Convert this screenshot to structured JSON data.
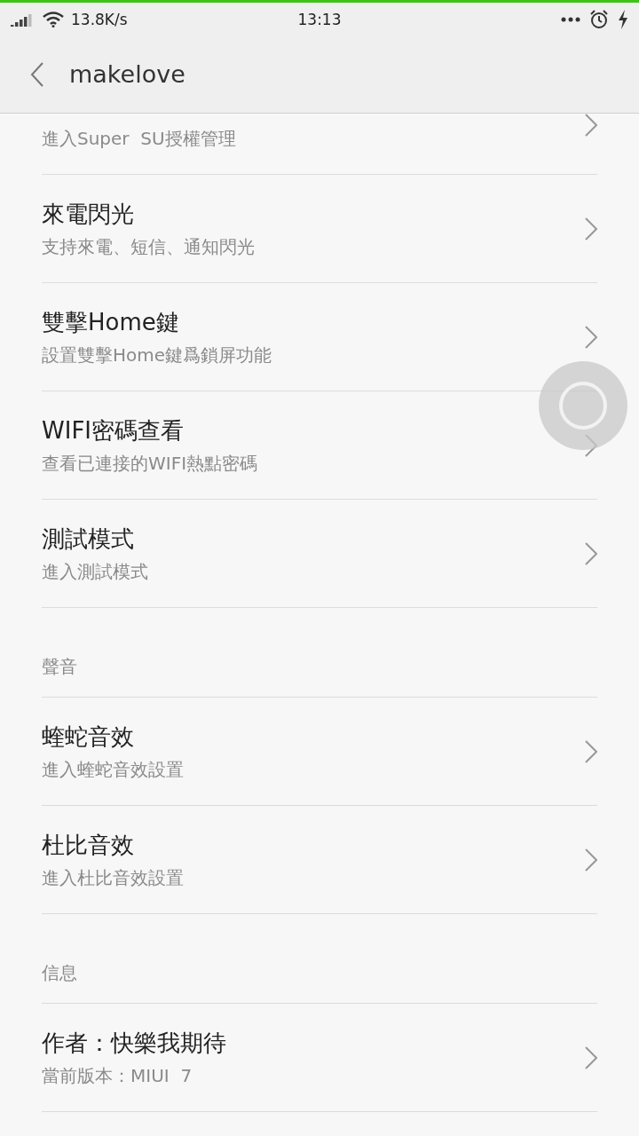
{
  "status_bar": {
    "speed": "13.8K/s",
    "time": "13:13"
  },
  "header": {
    "title": "makelove"
  },
  "list": [
    {
      "kind": "row",
      "subtitle": "進入Super  SU授權管理"
    },
    {
      "kind": "row",
      "title": "來電閃光",
      "subtitle": "支持來電、短信、通知閃光"
    },
    {
      "kind": "row",
      "title": "雙擊Home鍵",
      "subtitle": "設置雙擊Home鍵爲鎖屏功能"
    },
    {
      "kind": "row",
      "title": "WIFI密碼查看",
      "subtitle": "查看已連接的WIFI熱點密碼"
    },
    {
      "kind": "row",
      "title": "測試模式",
      "subtitle": "進入測試模式"
    },
    {
      "kind": "section",
      "title": "聲音"
    },
    {
      "kind": "row",
      "title": "蝰蛇音效",
      "subtitle": "進入蝰蛇音效設置"
    },
    {
      "kind": "row",
      "title": "杜比音效",
      "subtitle": "進入杜比音效設置"
    },
    {
      "kind": "section",
      "title": "信息"
    },
    {
      "kind": "row",
      "title": "作者：快樂我期待",
      "subtitle": "當前版本：MIUI  7"
    }
  ]
}
